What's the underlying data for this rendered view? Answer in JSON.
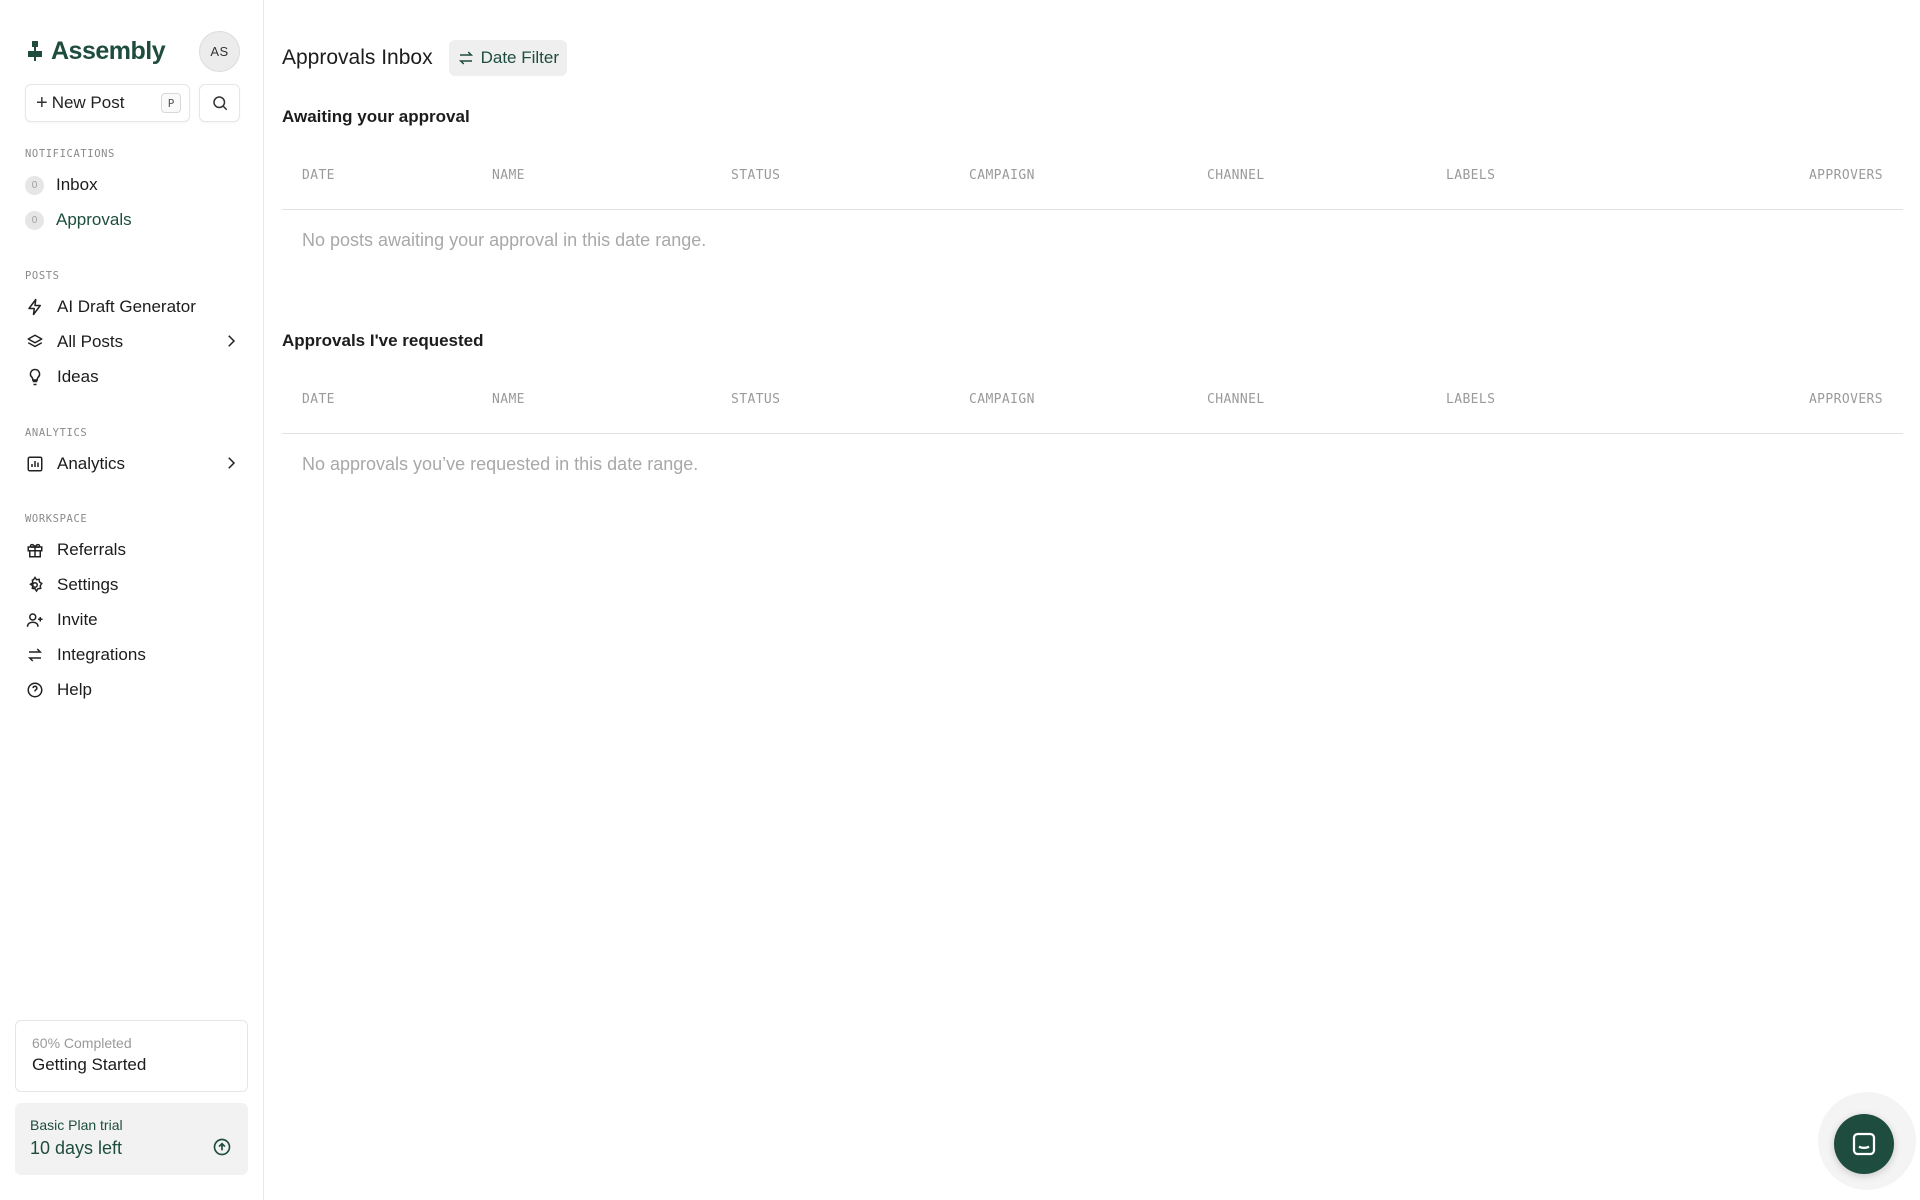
{
  "sidebar": {
    "logo_text": "Assembly",
    "avatar_initials": "AS",
    "new_post_label": "New Post",
    "new_post_shortcut": "P",
    "sections": {
      "notifications": "NOTIFICATIONS",
      "posts": "POSTS",
      "analytics": "ANALYTICS",
      "workspace": "WORKSPACE"
    },
    "notifications": [
      {
        "label": "Inbox",
        "count": "0"
      },
      {
        "label": "Approvals",
        "count": "0"
      }
    ],
    "posts": [
      {
        "label": "AI Draft Generator",
        "icon": "zap-icon"
      },
      {
        "label": "All Posts",
        "icon": "layers-icon"
      },
      {
        "label": "Ideas",
        "icon": "lightbulb-icon"
      }
    ],
    "analytics": [
      {
        "label": "Analytics",
        "icon": "chart-icon"
      }
    ],
    "workspace": [
      {
        "label": "Referrals",
        "icon": "gift-icon"
      },
      {
        "label": "Settings",
        "icon": "gear-icon"
      },
      {
        "label": "Invite",
        "icon": "user-plus-icon"
      },
      {
        "label": "Integrations",
        "icon": "arrows-icon"
      },
      {
        "label": "Help",
        "icon": "help-circle-icon"
      }
    ],
    "getting_started": {
      "progress": "60% Completed",
      "title": "Getting Started"
    },
    "trial": {
      "label": "Basic Plan trial",
      "days": "10 days left"
    }
  },
  "main": {
    "title": "Approvals Inbox",
    "date_filter_label": "Date Filter",
    "awaiting": {
      "heading": "Awaiting your approval",
      "columns": [
        "DATE",
        "NAME",
        "STATUS",
        "CAMPAIGN",
        "CHANNEL",
        "LABELS",
        "APPROVERS"
      ],
      "empty_text": "No posts awaiting your approval in this date range."
    },
    "requested": {
      "heading": "Approvals I've requested",
      "columns": [
        "DATE",
        "NAME",
        "STATUS",
        "CAMPAIGN",
        "CHANNEL",
        "LABELS",
        "APPROVERS"
      ],
      "empty_text": "No approvals you’ve requested in this date range."
    }
  },
  "colors": {
    "brand": "#1e4d3f",
    "muted": "#9a9a9a"
  }
}
